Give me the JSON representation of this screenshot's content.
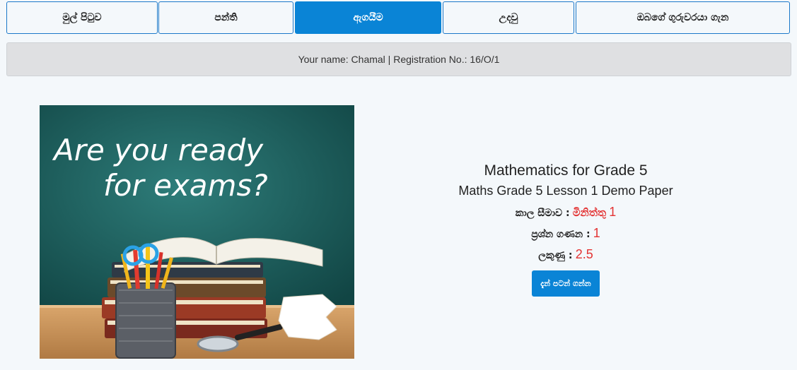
{
  "nav": {
    "tabs": [
      {
        "label": "මුල් පිටුව"
      },
      {
        "label": "පන්ති"
      },
      {
        "label": "ඇගයීම"
      },
      {
        "label": "උදවු"
      },
      {
        "label": "ඔබගේ ගුරුවරයා ගැන"
      }
    ],
    "active_index": 2
  },
  "user_bar": {
    "text": "Your name: Chamal | Registration No.: 16/O/1"
  },
  "hero_image": {
    "headline_line1": "Are you ready",
    "headline_line2": "for exams?"
  },
  "exam": {
    "course_title": "Mathematics for Grade 5",
    "paper_title": "Maths Grade 5 Lesson 1 Demo Paper",
    "time_label": "කාල සීමාව :",
    "time_value_unit": "මිනිත්තු",
    "time_value": "1",
    "questions_label": "ප්‍රශ්න ගණන :",
    "questions_value": "1",
    "marks_label": "ලකුණු :",
    "marks_value": "2.5",
    "start_button": "දැන් පටන් ගන්න"
  },
  "colors": {
    "accent": "#0a84d6",
    "highlight_red": "#e33333",
    "chalkboard": "#1d5b5a"
  }
}
